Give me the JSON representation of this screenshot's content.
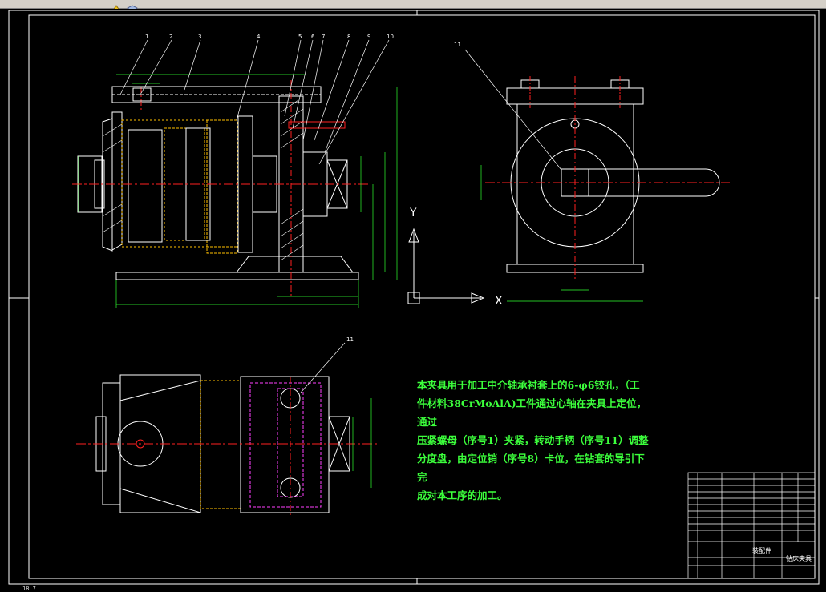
{
  "toolbar": {
    "icons": [
      "draw-order-icon",
      "layer-icon"
    ]
  },
  "status": {
    "coord_readout": "18.7"
  },
  "drawing": {
    "axis_y_label": "Y",
    "axis_x_label": "X",
    "part_numbers": [
      "1",
      "2",
      "3",
      "4",
      "5",
      "6",
      "7",
      "8",
      "9",
      "10",
      "11"
    ],
    "section_callout_top_right": "11",
    "section_callout_bottom": "11",
    "note_lines": [
      "本夹具用于加工中介轴承衬套上的6-φ6铰孔，（工",
      "件材料38CrMoAlA)工件通过心轴在夹具上定位，通过",
      "压紧螺母（序号1）夹紧，转动手柄（序号11）调整",
      "分度盘，由定位销（序号8）卡位，在钻套的导引下完",
      "成对本工序的加工。"
    ],
    "title_block": {
      "drawing_name": "钻床夹具",
      "label_a": "装配件"
    }
  },
  "colors": {
    "background": "#000000",
    "outline": "#ffffff",
    "centerline": "#ff2020",
    "hidden": "#ff40ff",
    "section": "#ffc000",
    "dimension": "#30ff30",
    "note": "#3cff3c",
    "toolbar": "#d4d0c8"
  }
}
